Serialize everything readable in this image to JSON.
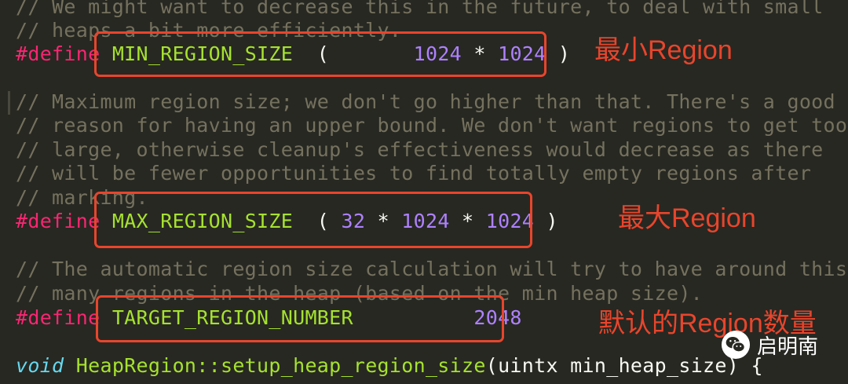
{
  "code": {
    "line1": "// We might want to decrease this in the future, to deal with small",
    "line2": "// heaps a bit more efficiently.",
    "define_kw": "#define",
    "min_name": "MIN_REGION_SIZE",
    "min_open": "  (       ",
    "min_v1": "1024",
    "min_mul": " * ",
    "min_v2": "1024",
    "min_close": " )",
    "c1": "// Maximum region size; we don't go higher than that. There's a good",
    "c2": "// reason for having an upper bound. We don't want regions to get too",
    "c3": "// large, otherwise cleanup's effectiveness would decrease as there",
    "c4": "// will be fewer opportunities to find totally empty regions after",
    "c5": "// marking.",
    "max_name": "MAX_REGION_SIZE",
    "max_open": "  ( ",
    "max_v1": "32",
    "max_mul1": " * ",
    "max_v2": "1024",
    "max_mul2": " * ",
    "max_v3": "1024",
    "max_close": " )",
    "t1": "// The automatic region size calculation will try to have around this",
    "t2": "// many regions in the heap (based on the min heap size).",
    "tgt_name": "TARGET_REGION_NUMBER",
    "tgt_pad": "          ",
    "tgt_val": "2048",
    "fn_type": "void",
    "fn_name": "HeapRegion::setup_heap_region_size",
    "fn_args": "(uintx min_heap_size) {"
  },
  "annotations": {
    "min": "最小Region",
    "max": "最大Region",
    "target": "默认的Region数量"
  },
  "watermark": {
    "icon": "wechat-icon",
    "text": "启明南"
  },
  "colors": {
    "background": "#272822",
    "comment": "#75715E",
    "keyword": "#F92672",
    "macro": "#A6E22E",
    "number": "#AE81FF",
    "annotation": "#E8452C"
  }
}
